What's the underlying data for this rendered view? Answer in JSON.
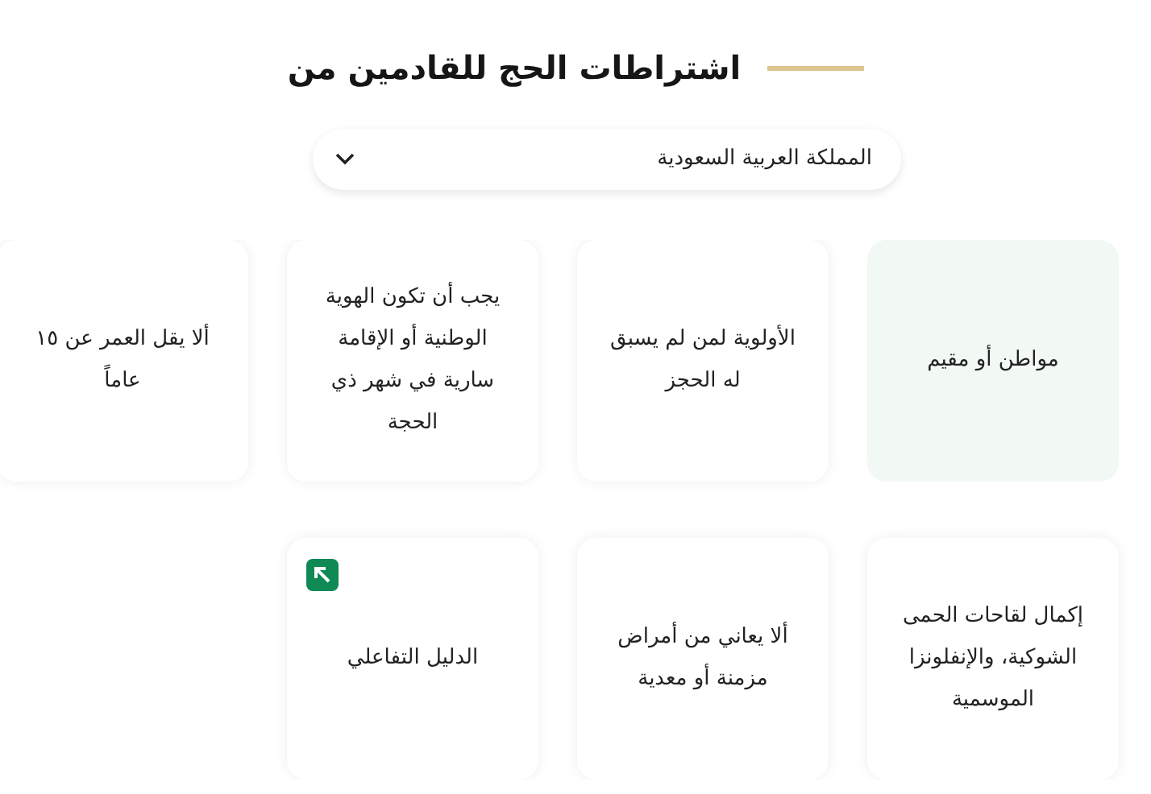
{
  "heading": "اشتراطات الحج للقادمين من",
  "country_select": {
    "value": "المملكة العربية السعودية"
  },
  "cards": [
    {
      "kind": "requirement",
      "text": "مواطن أو مقيم",
      "highlighted": true
    },
    {
      "kind": "requirement",
      "text": "الأولوية لمن لم يسبق له الحجز",
      "highlighted": false
    },
    {
      "kind": "requirement",
      "text": "يجب أن تكون الهوية الوطنية أو الإقامة سارية في شهر ذي الحجة",
      "highlighted": false
    },
    {
      "kind": "requirement",
      "text": "ألا يقل العمر عن ١٥ عاماً",
      "highlighted": false
    },
    {
      "kind": "requirement",
      "text": "إكمال لقاحات الحمى الشوكية، والإنفلونزا الموسمية",
      "highlighted": false
    },
    {
      "kind": "requirement",
      "text": "ألا يعاني من أمراض مزمنة أو معدية",
      "highlighted": false
    },
    {
      "kind": "link",
      "text": "الدليل التفاعلي",
      "highlighted": false
    }
  ]
}
